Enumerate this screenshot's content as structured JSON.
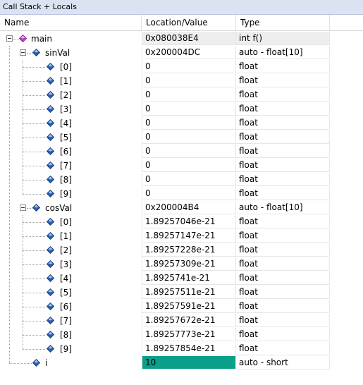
{
  "window": {
    "title": "Call Stack + Locals"
  },
  "columns": {
    "name": "Name",
    "location": "Location/Value",
    "type": "Type"
  },
  "rows": [
    {
      "name": "main",
      "value": "0x080038E4",
      "type": "int f()"
    },
    {
      "name": "sinVal",
      "value": "0x200004DC",
      "type": "auto - float[10]"
    },
    {
      "name": "[0]",
      "value": "0",
      "type": "float"
    },
    {
      "name": "[1]",
      "value": "0",
      "type": "float"
    },
    {
      "name": "[2]",
      "value": "0",
      "type": "float"
    },
    {
      "name": "[3]",
      "value": "0",
      "type": "float"
    },
    {
      "name": "[4]",
      "value": "0",
      "type": "float"
    },
    {
      "name": "[5]",
      "value": "0",
      "type": "float"
    },
    {
      "name": "[6]",
      "value": "0",
      "type": "float"
    },
    {
      "name": "[7]",
      "value": "0",
      "type": "float"
    },
    {
      "name": "[8]",
      "value": "0",
      "type": "float"
    },
    {
      "name": "[9]",
      "value": "0",
      "type": "float"
    },
    {
      "name": "cosVal",
      "value": "0x200004B4",
      "type": "auto - float[10]"
    },
    {
      "name": "[0]",
      "value": "1.89257046e-21",
      "type": "float"
    },
    {
      "name": "[1]",
      "value": "1.89257147e-21",
      "type": "float"
    },
    {
      "name": "[2]",
      "value": "1.89257228e-21",
      "type": "float"
    },
    {
      "name": "[3]",
      "value": "1.89257309e-21",
      "type": "float"
    },
    {
      "name": "[4]",
      "value": "1.8925741e-21",
      "type": "float"
    },
    {
      "name": "[5]",
      "value": "1.89257511e-21",
      "type": "float"
    },
    {
      "name": "[6]",
      "value": "1.89257591e-21",
      "type": "float"
    },
    {
      "name": "[7]",
      "value": "1.89257672e-21",
      "type": "float"
    },
    {
      "name": "[8]",
      "value": "1.89257773e-21",
      "type": "float"
    },
    {
      "name": "[9]",
      "value": "1.89257854e-21",
      "type": "float"
    },
    {
      "name": "i",
      "value": "10",
      "type": "auto - short"
    }
  ],
  "colors": {
    "function_icon": "#c040c0",
    "variable_icon": "#2a5fb0",
    "changed_value_bg": "#0a9f8a"
  },
  "icons": {
    "function": "function-diamond-icon",
    "variable": "variable-diamond-icon",
    "collapse": "collapse-minus-icon"
  }
}
